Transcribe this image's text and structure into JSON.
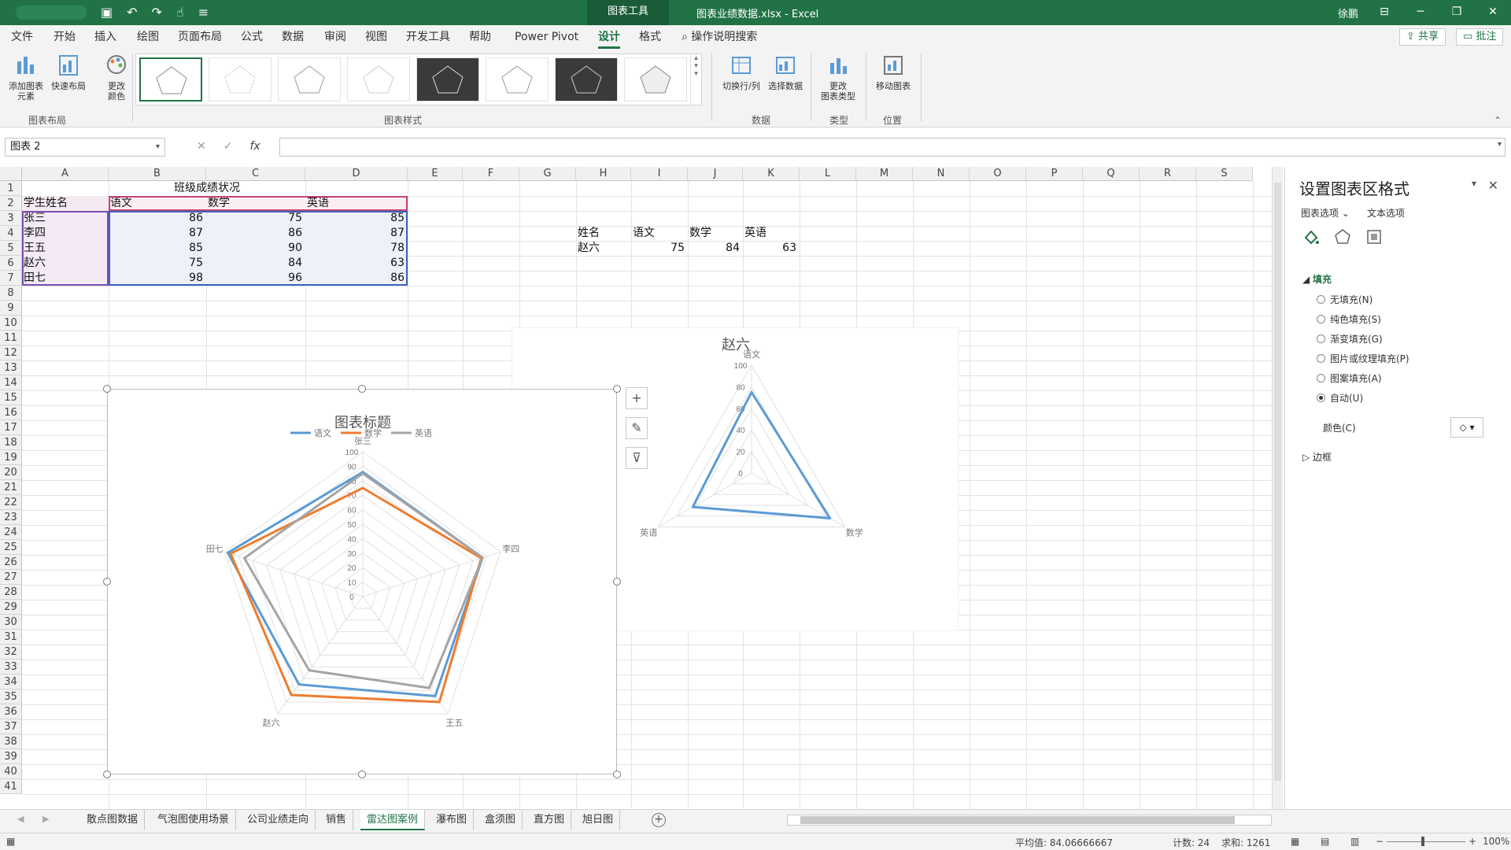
{
  "window": {
    "context_tab": "图表工具",
    "doc_title": "图表业绩数据.xlsx  -  Excel",
    "user": "徐鹏",
    "buttons": [
      "⊟",
      "─",
      "❐",
      "✕"
    ]
  },
  "tabs": [
    {
      "label": "文件"
    },
    {
      "label": "开始"
    },
    {
      "label": "插入"
    },
    {
      "label": "绘图"
    },
    {
      "label": "页面布局"
    },
    {
      "label": "公式"
    },
    {
      "label": "数据"
    },
    {
      "label": "审阅"
    },
    {
      "label": "视图"
    },
    {
      "label": "开发工具"
    },
    {
      "label": "帮助"
    },
    {
      "label": "Power Pivot"
    },
    {
      "label": "设计"
    },
    {
      "label": "格式"
    }
  ],
  "search_label": "操作说明搜索",
  "share_label": "共享",
  "comment_label": "批注",
  "ribbon": {
    "add_element": "添加图表\n元素",
    "quick_layout": "快速布局",
    "change_color": "更改\n颜色",
    "switch_rowcol": "切换行/列",
    "select_data": "选择数据",
    "change_type": "更改\n图表类型",
    "move_chart": "移动图表",
    "group_layout": "图表布局",
    "group_styles": "图表样式",
    "group_data": "数据",
    "group_type": "类型",
    "group_location": "位置"
  },
  "namebox": "图表 2",
  "fx_label": "fx",
  "columns": [
    "A",
    "B",
    "C",
    "D",
    "E",
    "F",
    "G",
    "H",
    "I",
    "J",
    "K",
    "L",
    "M",
    "N",
    "O",
    "P",
    "Q",
    "R",
    "S"
  ],
  "rows": [
    "1",
    "2",
    "3",
    "4",
    "5",
    "6",
    "7",
    "8",
    "9",
    "10",
    "11",
    "12",
    "13",
    "14",
    "15",
    "16",
    "17",
    "18",
    "19",
    "20",
    "21",
    "22",
    "23",
    "24",
    "25",
    "26",
    "27",
    "28",
    "29",
    "30",
    "31",
    "32",
    "33",
    "34",
    "35",
    "36",
    "37",
    "38",
    "39",
    "40",
    "41"
  ],
  "table": {
    "title": "班级成绩状况",
    "headers": [
      "学生姓名",
      "语文",
      "数学",
      "英语"
    ],
    "rows": [
      [
        "张三",
        "86",
        "75",
        "85"
      ],
      [
        "李四",
        "87",
        "86",
        "87"
      ],
      [
        "王五",
        "85",
        "90",
        "78"
      ],
      [
        "赵六",
        "75",
        "84",
        "63"
      ],
      [
        "田七",
        "98",
        "96",
        "86"
      ]
    ]
  },
  "lookup": {
    "headers": [
      "姓名",
      "语文",
      "数学",
      "英语"
    ],
    "row": [
      "赵六",
      "75",
      "84",
      "63"
    ]
  },
  "chart_data": [
    {
      "type": "radar",
      "title": "图表标题",
      "categories": [
        "张三",
        "李四",
        "王五",
        "赵六",
        "田七"
      ],
      "ylim": [
        0,
        100
      ],
      "ticks": [
        "0",
        "10",
        "20",
        "30",
        "40",
        "50",
        "60",
        "70",
        "80",
        "90",
        "100"
      ],
      "legend_position": "top",
      "series": [
        {
          "name": "语文",
          "values": [
            86,
            87,
            85,
            75,
            98
          ],
          "color": "#5b9bd5"
        },
        {
          "name": "数学",
          "values": [
            75,
            86,
            90,
            84,
            96
          ],
          "color": "#ed7d31"
        },
        {
          "name": "英语",
          "values": [
            85,
            87,
            78,
            63,
            86
          ],
          "color": "#a5a5a5"
        }
      ]
    },
    {
      "type": "radar",
      "title": "赵六",
      "categories": [
        "语文",
        "数学",
        "英语"
      ],
      "ylim": [
        0,
        100
      ],
      "ticks": [
        "0",
        "20",
        "40",
        "60",
        "80",
        "100"
      ],
      "series": [
        {
          "values": [
            75,
            84,
            63
          ],
          "color": "#5b9bd5"
        }
      ]
    }
  ],
  "chart_buttons": [
    "+",
    "✎",
    "⊽"
  ],
  "pane": {
    "title": "设置图表区格式",
    "tab_chart": "图表选项",
    "tab_text": "文本选项",
    "section_fill": "填充",
    "options": [
      "无填充(N)",
      "纯色填充(S)",
      "渐变填充(G)",
      "图片或纹理填充(P)",
      "图案填充(A)",
      "自动(U)"
    ],
    "color_label": "颜色(C)",
    "section_border": "边框"
  },
  "sheets": [
    "散点图数据",
    "气泡图使用场景",
    "公司业绩走向",
    "销售",
    "雷达图案例",
    "瀑布图",
    "盒须图",
    "直方图",
    "旭日图"
  ],
  "active_sheet": "雷达图案例",
  "status": {
    "average": "平均值: 84.06666667",
    "count": "计数: 24",
    "sum": "求和: 1261",
    "zoom": "100%"
  }
}
